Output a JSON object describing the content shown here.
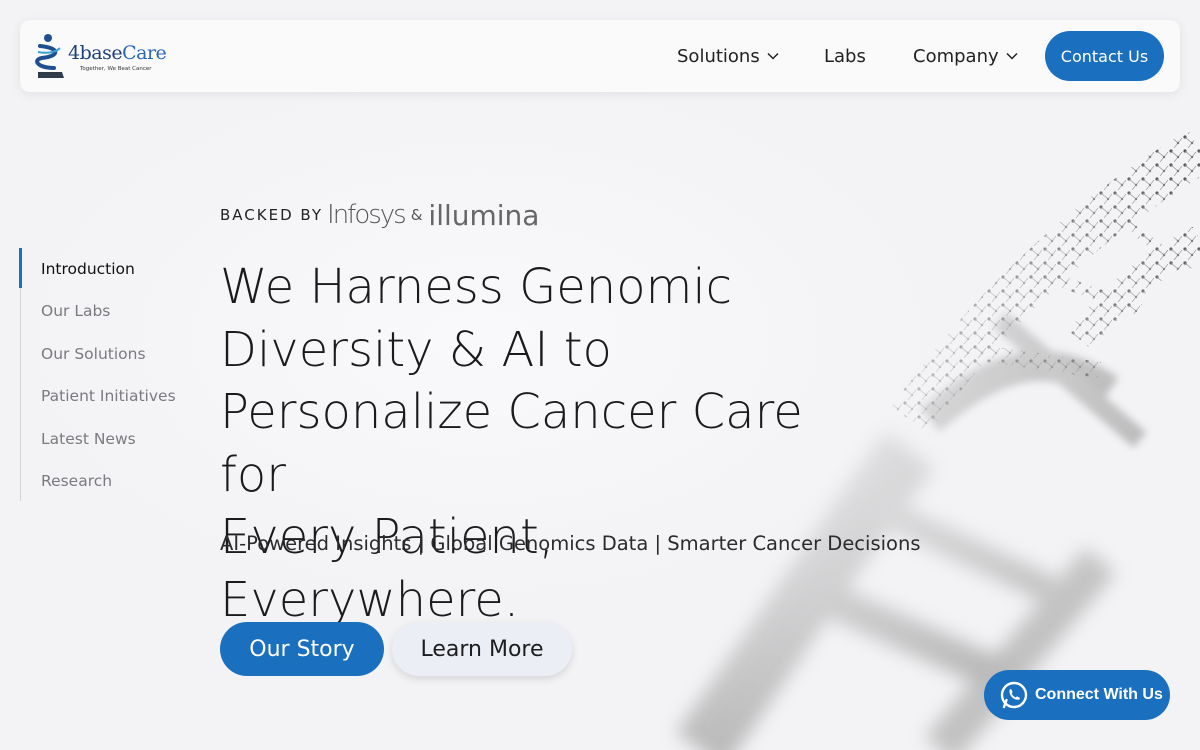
{
  "brand": {
    "logo_text_a": "4base",
    "logo_text_b": "Care",
    "tagline": "Together, We Beat Cancer",
    "accent_color": "#1a6fbf"
  },
  "header": {
    "nav": [
      {
        "label": "Solutions",
        "has_dropdown": true
      },
      {
        "label": "Labs",
        "has_dropdown": false
      },
      {
        "label": "Company",
        "has_dropdown": true
      }
    ],
    "contact_label": "Contact Us"
  },
  "sidenav": {
    "items": [
      {
        "label": "Introduction",
        "active": true
      },
      {
        "label": "Our Labs",
        "active": false
      },
      {
        "label": "Our Solutions",
        "active": false
      },
      {
        "label": "Patient Initiatives",
        "active": false
      },
      {
        "label": "Latest News",
        "active": false
      },
      {
        "label": "Research",
        "active": false
      }
    ]
  },
  "hero": {
    "backed_label": "BACKED BY",
    "partner_1": "Infosys",
    "amp": "&",
    "partner_2": "illumina",
    "headline_lines": [
      "We Harness Genomic",
      "Diversity & AI to",
      "Personalize Cancer Care for",
      "Every Patient, Everywhere."
    ],
    "subline": "AI-Powered Insights | Global Genomics Data | Smarter Cancer Decisions",
    "primary_button": "Our Story",
    "secondary_button": "Learn More"
  },
  "floating": {
    "connect_label": "Connect With Us",
    "connect_icon": "whatsapp-icon"
  }
}
